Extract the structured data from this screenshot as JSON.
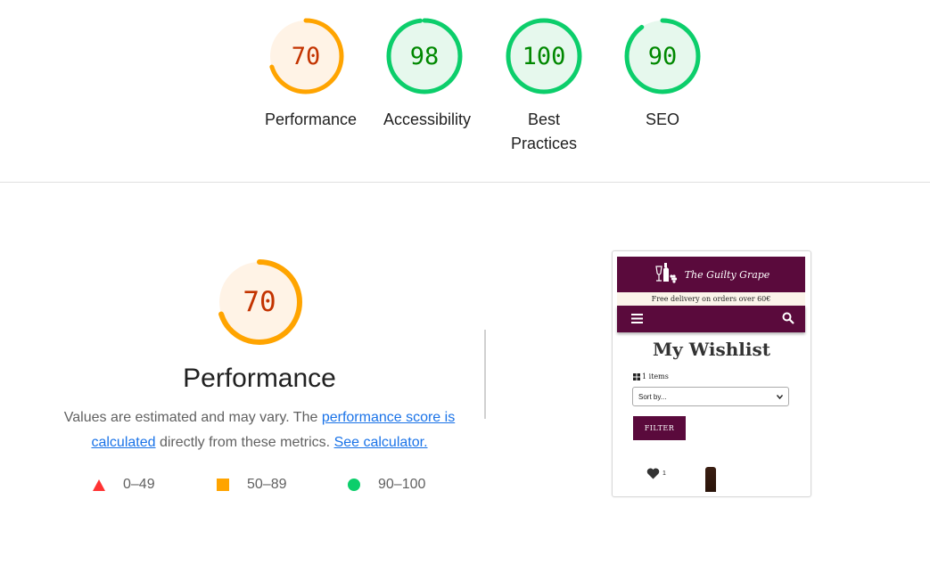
{
  "colors": {
    "fail": "#ff3333",
    "average": "#ffa400",
    "pass": "#0cce6b",
    "average_text": "#c33300",
    "pass_text": "#008800",
    "average_bg": "#fff3e6",
    "pass_bg": "#e6f8ed",
    "brand": "#5a0a3c"
  },
  "scores": [
    {
      "value": "70",
      "label": "Performance",
      "score": 70
    },
    {
      "value": "98",
      "label": "Accessibility",
      "score": 98
    },
    {
      "value": "100",
      "label": "Best Practices",
      "score": 100
    },
    {
      "value": "90",
      "label": "SEO",
      "score": 90
    }
  ],
  "performance": {
    "value": "70",
    "score": 70,
    "title": "Performance",
    "desc_prefix": "Values are estimated and may vary. The ",
    "desc_link1": "performance score is calculated",
    "desc_middle": " directly from these metrics. ",
    "desc_link2": "See calculator."
  },
  "legend": [
    {
      "range": "0–49",
      "icon": "triangle-icon"
    },
    {
      "range": "50–89",
      "icon": "square-icon"
    },
    {
      "range": "90–100",
      "icon": "circle-icon"
    }
  ],
  "screenshot": {
    "logo_text": "The Guilty Grape",
    "promo": "Free delivery on orders over 60€",
    "page_title": "My Wishlist",
    "items_count": "1 items",
    "sort_value": "Sort by...",
    "filter_label": "FILTER",
    "heart_count": "1"
  }
}
